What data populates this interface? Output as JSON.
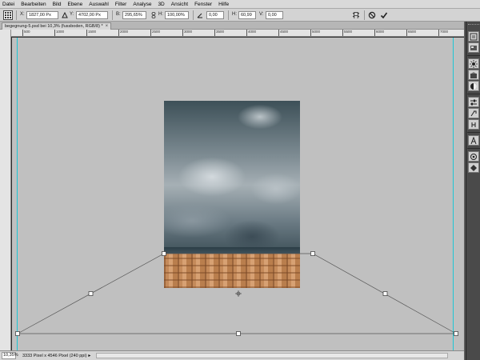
{
  "menu": [
    "Datei",
    "Bearbeiten",
    "Bild",
    "Ebene",
    "Auswahl",
    "Filter",
    "Analyse",
    "3D",
    "Ansicht",
    "Fenster",
    "Hilfe"
  ],
  "options": {
    "x_label": "X:",
    "x_value": "1827,00 Px",
    "y_label": "Y:",
    "y_value": "4702,00 Px",
    "w_label": "B:",
    "w_value": "295,65%",
    "h_label": "H:",
    "h_value": "100,00%",
    "angle_value": "0,00",
    "hskew_label": "H:",
    "hskew_value": "60,99",
    "vskew_label": "V:",
    "vskew_value": "0,00",
    "cancel_icon": "cancel-transform-icon",
    "commit_icon": "commit-checkmark-icon",
    "warp_icon": "warp-icon"
  },
  "document": {
    "tab_title": "begegnung-5.psd bei 10,3% (fussboden, RGB/8) *",
    "close_glyph": "×"
  },
  "ruler": {
    "ticks": [
      "500",
      "1000",
      "1500",
      "2000",
      "2500",
      "3000",
      "3500",
      "4000",
      "4500",
      "5000",
      "5500",
      "6000",
      "6500",
      "7000"
    ],
    "corner_label": "500"
  },
  "status": {
    "zoom": "10,35%",
    "doc_info": "3333 Pixel x 4546 Pixel (240 ppi)",
    "menu_arrow": "▸"
  },
  "dock_icons": [
    "history-icon",
    "properties-icon",
    "brush-icon",
    "clone-source-icon",
    "swatches-icon",
    "color-icon",
    "adjustments-icon",
    "styles-icon",
    "character-icon",
    "paragraph-icon",
    "layers-icon",
    "channels-icon"
  ],
  "colors": {
    "guide": "#1fc6d4",
    "canvas_bg": "#c0c0c0",
    "dock_bg": "#4a4a4a"
  }
}
